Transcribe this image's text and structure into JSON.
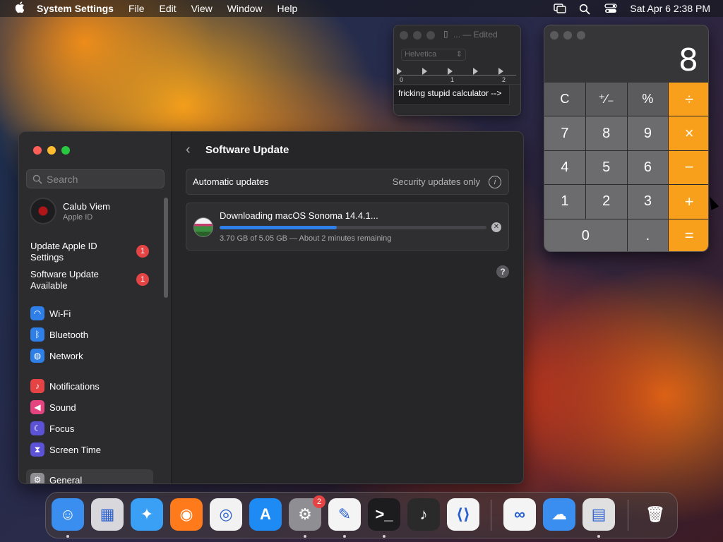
{
  "menubar": {
    "app_name": "System Settings",
    "items": [
      "File",
      "Edit",
      "View",
      "Window",
      "Help"
    ],
    "clock": "Sat Apr 6  2:38 PM"
  },
  "settings": {
    "search_placeholder": "Search",
    "user": {
      "name": "Calub Viem",
      "subtitle": "Apple ID"
    },
    "notices": [
      {
        "label": "Update Apple ID Settings",
        "badge": "1"
      },
      {
        "label": "Software Update Available",
        "badge": "1"
      }
    ],
    "nav_items": [
      {
        "label": "Wi-Fi",
        "icon": "wifi-icon",
        "color": "#2f7fe8"
      },
      {
        "label": "Bluetooth",
        "icon": "bluetooth-icon",
        "color": "#2f7fe8"
      },
      {
        "label": "Network",
        "icon": "globe-icon",
        "color": "#2f7fe8"
      },
      {
        "label": "Notifications",
        "icon": "bell-icon",
        "color": "#e64444"
      },
      {
        "label": "Sound",
        "icon": "speaker-icon",
        "color": "#e64480"
      },
      {
        "label": "Focus",
        "icon": "moon-icon",
        "color": "#5b52d6"
      },
      {
        "label": "Screen Time",
        "icon": "hourglass-icon",
        "color": "#5b52d6"
      },
      {
        "label": "General",
        "icon": "gear-icon",
        "color": "#8e8e93"
      }
    ],
    "page_title": "Software Update",
    "automatic_updates": {
      "label": "Automatic updates",
      "value": "Security updates only"
    },
    "download": {
      "title": "Downloading macOS Sonoma 14.4.1...",
      "progress": 0.44,
      "status": "3.70 GB of 5.05 GB — About 2 minutes remaining"
    },
    "help": "?"
  },
  "textedit": {
    "title": "...  — Edited",
    "font": "Helvetica",
    "ruler_numbers": [
      "0",
      "1",
      "2"
    ],
    "text": "fricking stupid calculator -->"
  },
  "calculator": {
    "display": "8",
    "keys": [
      {
        "label": "C",
        "kind": "fn"
      },
      {
        "label": "⁺∕₋",
        "kind": "fn"
      },
      {
        "label": "%",
        "kind": "fn"
      },
      {
        "label": "÷",
        "kind": "op"
      },
      {
        "label": "7",
        "kind": "num"
      },
      {
        "label": "8",
        "kind": "num"
      },
      {
        "label": "9",
        "kind": "num"
      },
      {
        "label": "×",
        "kind": "op"
      },
      {
        "label": "4",
        "kind": "num"
      },
      {
        "label": "5",
        "kind": "num"
      },
      {
        "label": "6",
        "kind": "num"
      },
      {
        "label": "−",
        "kind": "op"
      },
      {
        "label": "1",
        "kind": "num"
      },
      {
        "label": "2",
        "kind": "num"
      },
      {
        "label": "3",
        "kind": "num"
      },
      {
        "label": "+",
        "kind": "op"
      },
      {
        "label": "0",
        "kind": "num zero"
      },
      {
        "label": ".",
        "kind": "num"
      },
      {
        "label": "=",
        "kind": "op"
      }
    ]
  },
  "dock": {
    "apps": [
      {
        "name": "finder-icon",
        "glyph": "☺",
        "bg": "#3a8ef0",
        "running": true
      },
      {
        "name": "launchpad-icon",
        "glyph": "▦",
        "bg": "#d8d8dc",
        "running": false
      },
      {
        "name": "safari-icon",
        "glyph": "✦",
        "bg": "#3aa0f5",
        "running": false
      },
      {
        "name": "firefox-icon",
        "glyph": "◉",
        "bg": "#ff7a1a",
        "running": false
      },
      {
        "name": "chrome-icon",
        "glyph": "◎",
        "bg": "#f2f2f2",
        "running": false
      },
      {
        "name": "app-store-icon",
        "glyph": "A",
        "bg": "#1e8bf5",
        "running": false
      },
      {
        "name": "system-settings-icon",
        "glyph": "⚙",
        "bg": "#8e8e93",
        "running": true,
        "badge": "2"
      },
      {
        "name": "textedit-icon",
        "glyph": "✎",
        "bg": "#f4f4f4",
        "running": true
      },
      {
        "name": "terminal-icon",
        "glyph": ">_",
        "bg": "#1c1c1e",
        "running": true
      },
      {
        "name": "garageband-icon",
        "glyph": "♪",
        "bg": "#2a2a2a",
        "running": false
      },
      {
        "name": "vscode-icon",
        "glyph": "⟨⟩",
        "bg": "#f4f4f4",
        "running": false
      },
      {
        "name": "visual-studio-icon",
        "glyph": "∞",
        "bg": "#f4f4f4",
        "running": false
      },
      {
        "name": "weather-icon",
        "glyph": "☁",
        "bg": "#3a8ef0",
        "running": false
      },
      {
        "name": "calculator-icon",
        "glyph": "▤",
        "bg": "#e0e0e0",
        "running": true
      },
      {
        "name": "trash-icon",
        "glyph": "🗑",
        "bg": "transparent",
        "running": false
      }
    ]
  }
}
